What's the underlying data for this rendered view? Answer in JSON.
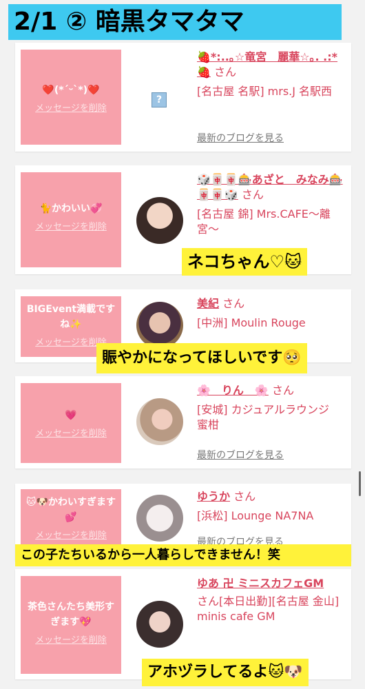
{
  "header": {
    "title": "2/1 ② 暗黒タマタマ"
  },
  "cards": [
    {
      "message": "❤️(*´ᵕ`*)❤️",
      "delete_label": "メッセージを削除",
      "name": "🍓*:..｡☆竜宮　麗華☆｡. .:*🍓",
      "san": "さん",
      "shop": "[名古屋 名駅] mrs.J 名駅西",
      "blog_link": "最新のブログを見る"
    },
    {
      "message": "🐈かわいい💞",
      "delete_label": "メッセージを削除",
      "name": "🎲🀄🀄🎰あざと　みなみ🎰🀄🀄🎲",
      "san": "さん",
      "shop": "[名古屋 錦] Mrs.CAFE〜離宮〜",
      "blog_link": ""
    },
    {
      "message": "BIGEvent満載ですね✨",
      "delete_label": "メッセージを削除",
      "name": "美紀",
      "san": "さん",
      "shop": "[中洲] Moulin Rouge",
      "blog_link": ""
    },
    {
      "message": "💗",
      "delete_label": "メッセージを削除",
      "name": "🌸　りん　🌸",
      "san": "さん",
      "shop": "[安城] カジュアルラウンジ　蜜柑",
      "blog_link": "最新のブログを見る"
    },
    {
      "message": "🐱🐶かわいすぎます💕",
      "delete_label": "メッセージを削除",
      "name": "ゆうか",
      "san": "さん",
      "shop": "[浜松] Lounge NA7NA",
      "blog_link": "最新のブログを見る"
    },
    {
      "message": "茶色さんたち美形すぎます💖",
      "delete_label": "メッセージを削除",
      "name": "ゆあ 卍 ミニスカフェGM",
      "san": "さん",
      "shop": "[本日出勤][名古屋 金山] minis cafe GM",
      "blog_link": ""
    }
  ],
  "overlays": {
    "caption1": "ネコちゃん♡🐱",
    "caption2": "賑やかになってほしいです🥺",
    "caption3": "この子たちいるから一人暮らしできません！笑",
    "caption4": "アホヅラしてるよ🐱🐶"
  },
  "colors": {
    "title_banner": "#3ec9f0",
    "message_box": "#f7a1ab",
    "name_text": "#d8445c",
    "caption_bg": "#fff23a"
  }
}
